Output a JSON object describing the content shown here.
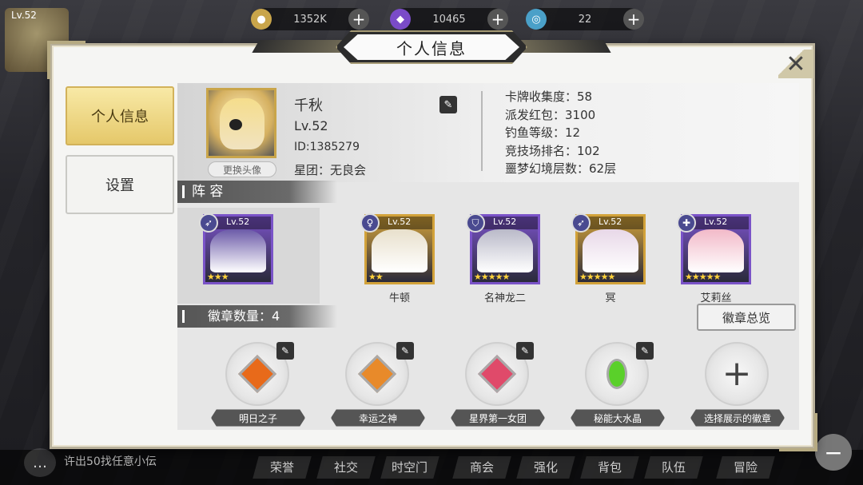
{
  "topbar": {
    "player_level": "Lv.52",
    "resources": [
      {
        "icon": "gold-coin-icon",
        "value": "1352K",
        "color": "#c9a54a"
      },
      {
        "icon": "purple-crystal-icon",
        "value": "10465",
        "color": "#7a4bc8"
      },
      {
        "icon": "stamina-orb-icon",
        "value": "22",
        "color": "#4aa0c8"
      }
    ]
  },
  "modal": {
    "title": "个人信息",
    "tabs": [
      {
        "label": "个人信息",
        "active": true
      },
      {
        "label": "设置",
        "active": false
      }
    ]
  },
  "profile": {
    "name": "千秋",
    "level": "Lv.52",
    "id": "ID:1385279",
    "guild": "星团：无良会",
    "change_avatar": "更换头像",
    "stats": [
      "卡牌收集度：58",
      "派发红包：3100",
      "钓鱼等级：12",
      "竞技场排名：102",
      "噩梦幻境层数：62层"
    ]
  },
  "lineup": {
    "title": "阵 容",
    "cards": [
      {
        "level": "Lv.52",
        "name": "",
        "stars": "★★★",
        "frame": "#7a53c8",
        "tone": "#6b5aa8",
        "class_icon": "bow-class-icon"
      },
      {
        "level": "Lv.52",
        "name": "牛顿",
        "stars": "★★",
        "frame": "#d2a23a",
        "tone": "#e8e0cc",
        "class_icon": "mage-class-icon"
      },
      {
        "level": "Lv.52",
        "name": "名神龙二",
        "stars": "★★★★★",
        "frame": "#7a53c8",
        "tone": "#b9b9c8",
        "class_icon": "shield-class-icon"
      },
      {
        "level": "Lv.52",
        "name": "冥",
        "stars": "★★★★★",
        "frame": "#d2a23a",
        "tone": "#e8d8e8",
        "class_icon": "bow-class-icon"
      },
      {
        "level": "Lv.52",
        "name": "艾莉丝",
        "stars": "★★★★★",
        "frame": "#7a53c8",
        "tone": "#f2b9c8",
        "class_icon": "healer-class-icon"
      }
    ]
  },
  "badges": {
    "count_label": "徽章数量：4",
    "overview_button": "徽章总览",
    "items": [
      {
        "label": "明日之子",
        "gem_color": "#e86a1a"
      },
      {
        "label": "幸运之神",
        "gem_color": "#e88a2a"
      },
      {
        "label": "星界第一女团",
        "gem_color": "#e04a6a"
      },
      {
        "label": "秘能大水晶",
        "gem_color": "#5ad02a"
      }
    ],
    "add_label": "选择展示的徽章"
  },
  "bottom_nav": {
    "chat_preview": "许出50找任意小伝",
    "items": [
      "荣誉",
      "社交",
      "时空门",
      "商会",
      "强化",
      "背包",
      "队伍",
      "冒险"
    ]
  }
}
